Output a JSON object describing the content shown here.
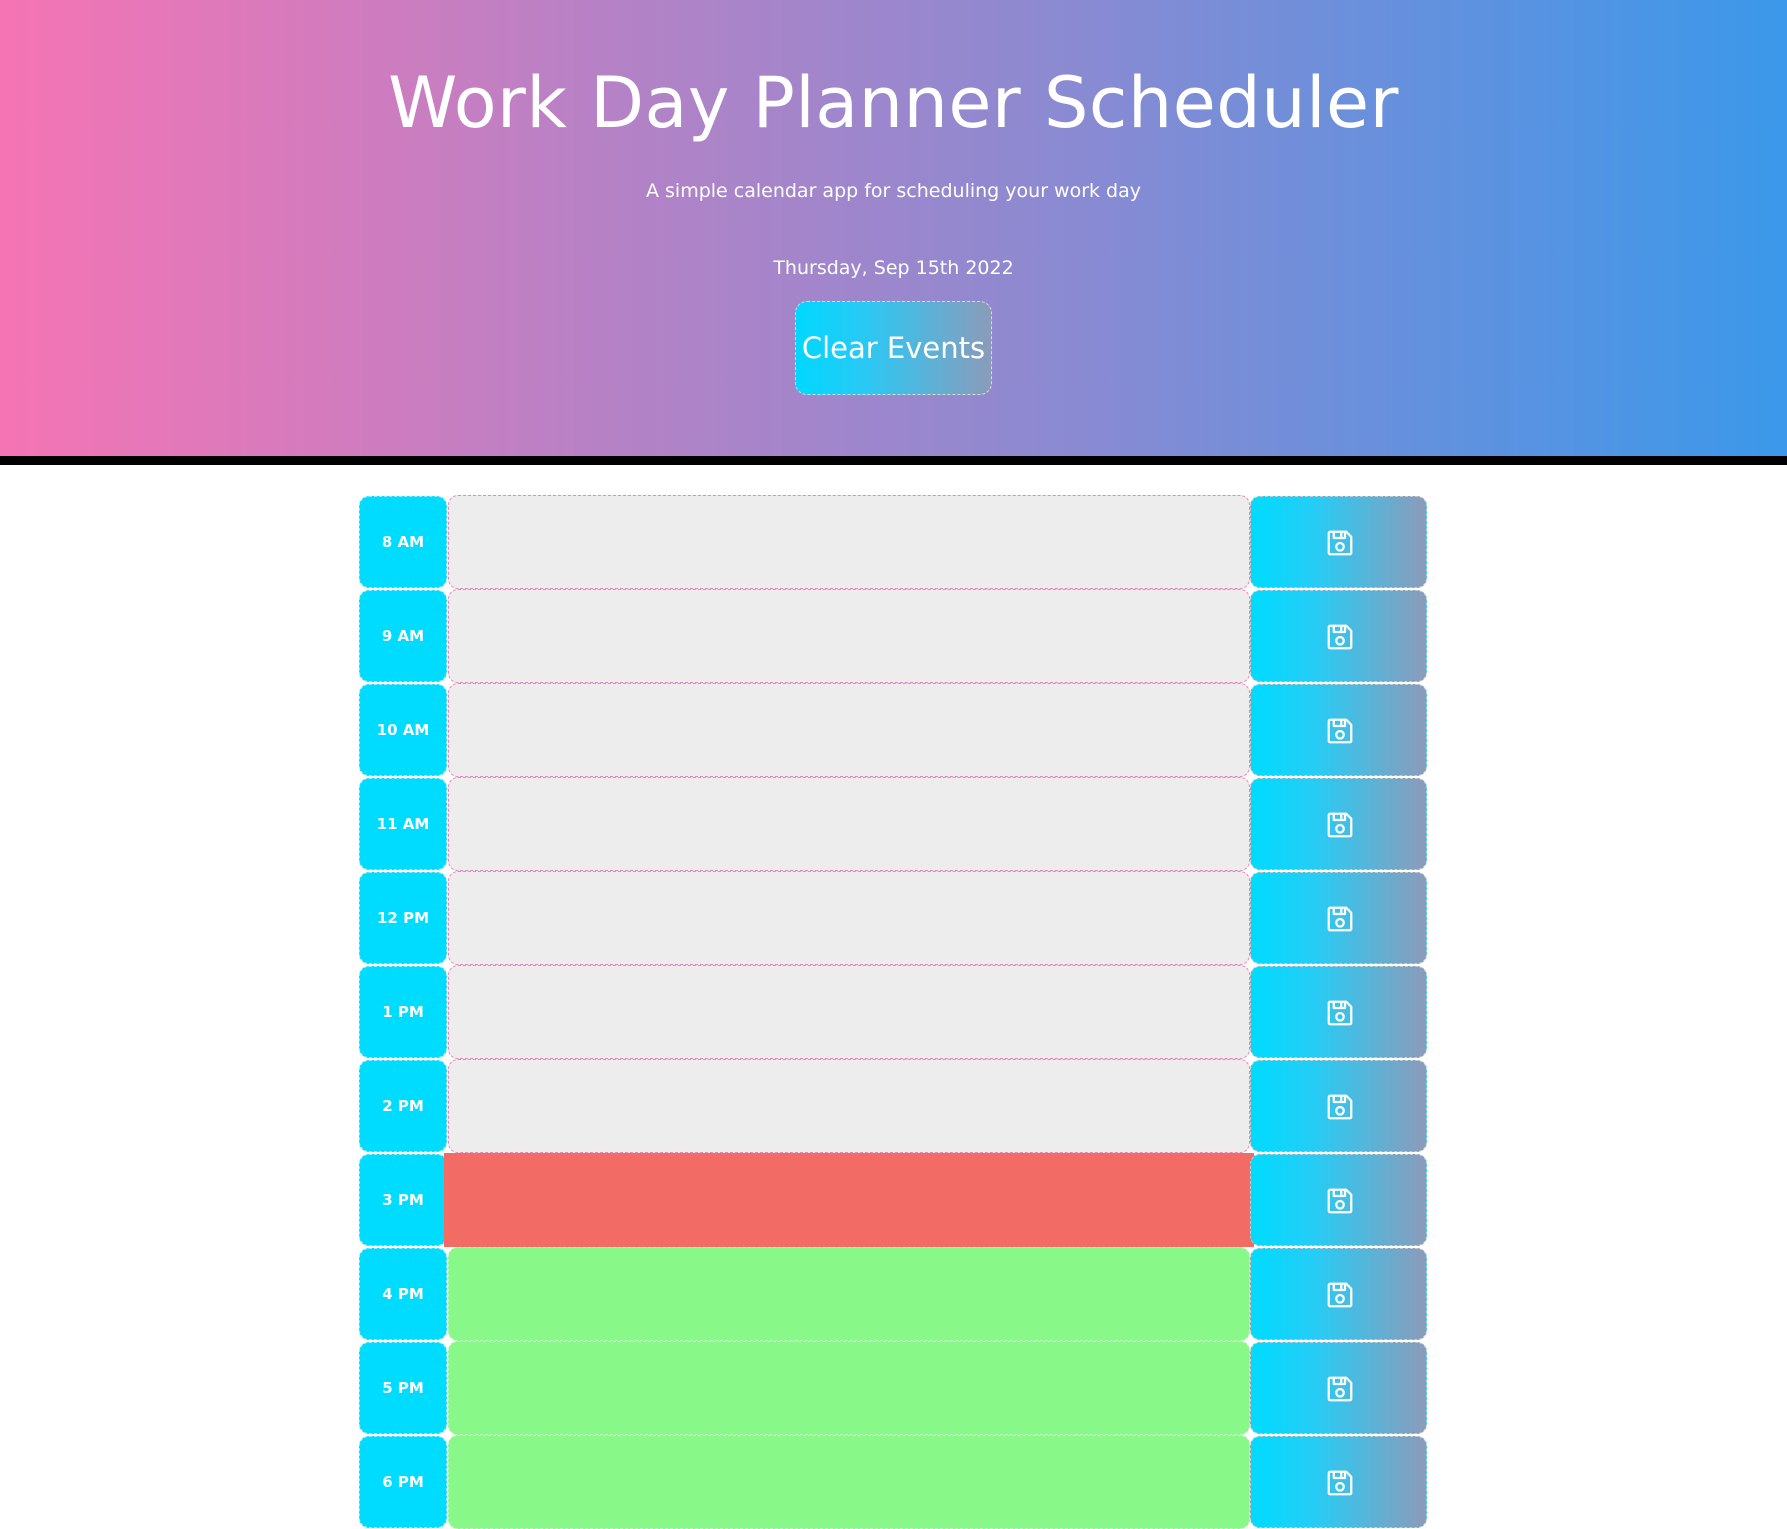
{
  "header": {
    "title": "Work Day Planner Scheduler",
    "subtitle": "A simple calendar app for scheduling your work day",
    "date": "Thursday, Sep 15th 2022",
    "clear_label": "Clear Events"
  },
  "colors": {
    "past": "#ededed",
    "present": "#f26b64",
    "future": "#88f889",
    "hour_label_bg": "#00dcff"
  },
  "save_icon": "floppy-disk-icon",
  "time_blocks": [
    {
      "hour": "8 AM",
      "status": "past",
      "text": ""
    },
    {
      "hour": "9 AM",
      "status": "past",
      "text": ""
    },
    {
      "hour": "10 AM",
      "status": "past",
      "text": ""
    },
    {
      "hour": "11 AM",
      "status": "past",
      "text": ""
    },
    {
      "hour": "12 PM",
      "status": "past",
      "text": ""
    },
    {
      "hour": "1 PM",
      "status": "past",
      "text": ""
    },
    {
      "hour": "2 PM",
      "status": "past",
      "text": ""
    },
    {
      "hour": "3 PM",
      "status": "present",
      "text": ""
    },
    {
      "hour": "4 PM",
      "status": "future",
      "text": ""
    },
    {
      "hour": "5 PM",
      "status": "future",
      "text": ""
    },
    {
      "hour": "6 PM",
      "status": "future",
      "text": ""
    }
  ]
}
